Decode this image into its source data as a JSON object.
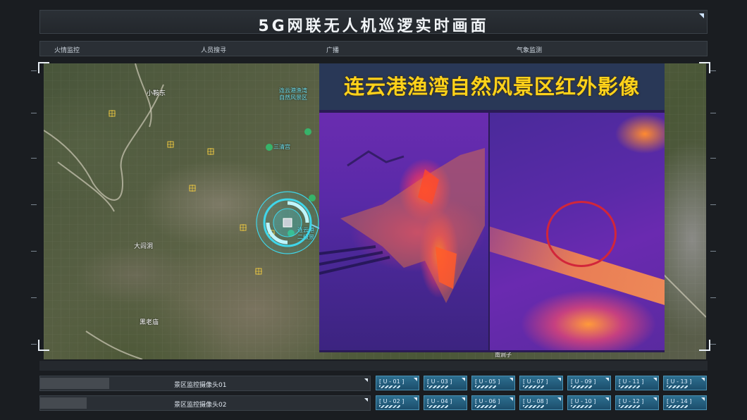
{
  "header": {
    "title": "5G网联无人机巡逻实时画面"
  },
  "nav": {
    "items": [
      "火情监控",
      "人员搜寻",
      "广播",
      "气象监测"
    ]
  },
  "map": {
    "labels": {
      "village1": "小鞍东",
      "village2": "大闾洞",
      "village3": "黑老庙",
      "south": "南涧子",
      "small_poi": "三清宫"
    },
    "poi_label_lines": [
      "连云港渔湾",
      "自然风景区"
    ],
    "poi2_label_lines": [
      "连云港",
      "二级景"
    ]
  },
  "infrared": {
    "title": "连云港渔湾自然风景区红外影像",
    "highlight_color": "#d2263a",
    "title_color": "#ffd21a"
  },
  "cameras": [
    {
      "label": "景区监控摄像头01",
      "progress": 0.21
    },
    {
      "label": "景区监控摄像头02",
      "progress": 0.14
    }
  ],
  "units_row1": [
    "[ U - 01 ]",
    "[ U - 03 ]",
    "[ U - 05 ]",
    "[ U - 07 ]",
    "[ U - 09 ]",
    "[ U - 11 ]",
    "[ U - 13 ]"
  ],
  "units_row2": [
    "[ U - 02 ]",
    "[ U - 04 ]",
    "[ U - 06 ]",
    "[ U - 08 ]",
    "[ U - 10 ]",
    "[ U - 12 ]",
    "[ U - 14 ]"
  ],
  "colors": {
    "accent": "#2d6f90",
    "reticle": "#3fd6ea"
  }
}
